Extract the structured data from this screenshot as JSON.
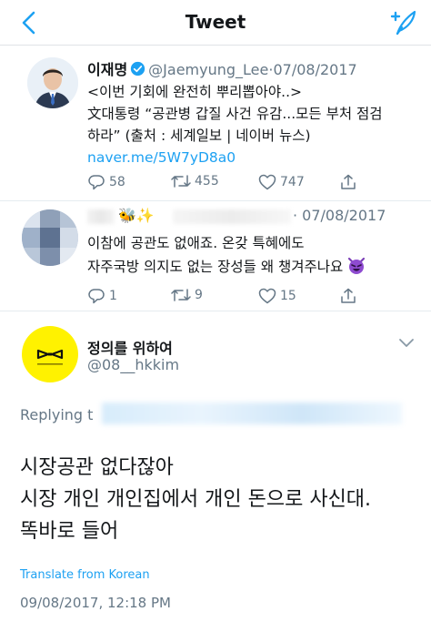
{
  "header": {
    "title": "Tweet"
  },
  "quoted_tweet": {
    "name": "이재명",
    "handle": "@Jaemyung_Lee",
    "separator": "·",
    "date": "07/08/2017",
    "lines": [
      "<이번 기회에 완전히 뿌리뽑아야..>",
      "文대통령 “공관병 갑질 사건 유감...모든 부처 점검",
      "하라” (출처 : 세계일보 | 네이버 뉴스)"
    ],
    "link": "naver.me/5W7yD8a0",
    "replies": "58",
    "retweets": "455",
    "likes": "747"
  },
  "reply_tweet": {
    "emoji": "🐝✨",
    "date": "· 07/08/2017",
    "lines": [
      "이참에 공관도 없애죠. 온갖 특혜에도",
      "자주국방 의지도 없는 장성들 왜 챙겨주나요"
    ],
    "replies": "1",
    "retweets": "9",
    "likes": "15"
  },
  "main_tweet": {
    "name": "정의를 위하여",
    "handle": "@08__hkkim",
    "replying_prefix": "Replying t",
    "lines": [
      "시장공관 없다잖아",
      "시장 개인 개인집에서 개인 돈으로 사신대.",
      "똑바로 들어"
    ],
    "translate": "Translate from Korean",
    "timestamp": "09/08/2017, 12:18 PM"
  },
  "colors": {
    "accent": "#1da1f2",
    "secondary_text": "#657786",
    "avatar_yellow": "#fff200"
  }
}
